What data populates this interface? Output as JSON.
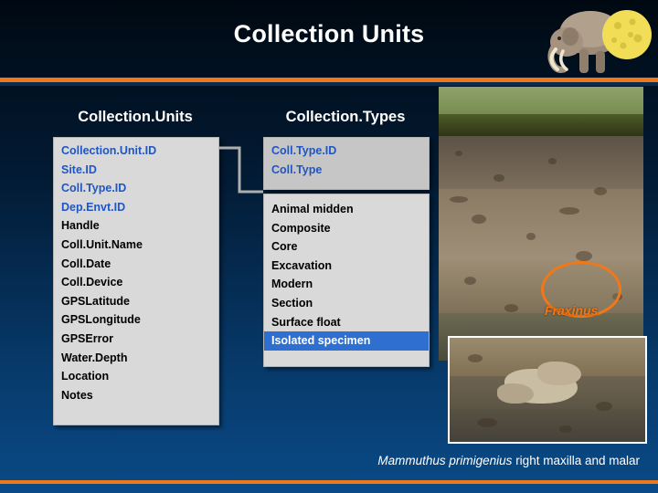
{
  "slide": {
    "title": "Collection Units",
    "accent_orange": "#f07818",
    "accent_blue": "#2f6fd0",
    "background": "#021a33"
  },
  "columns": {
    "units_heading": "Collection.Units",
    "types_heading": "Collection.Types"
  },
  "units_table": {
    "fields": [
      {
        "label": "Collection.Unit.ID",
        "key": true
      },
      {
        "label": "Site.ID",
        "key": true
      },
      {
        "label": "Coll.Type.ID",
        "key": true
      },
      {
        "label": "Dep.Envt.ID",
        "key": true
      },
      {
        "label": "Handle",
        "key": false
      },
      {
        "label": "Coll.Unit.Name",
        "key": false
      },
      {
        "label": "Coll.Date",
        "key": false
      },
      {
        "label": "Coll.Device",
        "key": false
      },
      {
        "label": "GPSLatitude",
        "key": false
      },
      {
        "label": "GPSLongitude",
        "key": false
      },
      {
        "label": "GPSError",
        "key": false
      },
      {
        "label": "Water.Depth",
        "key": false
      },
      {
        "label": "Location",
        "key": false
      },
      {
        "label": "Notes",
        "key": false
      }
    ]
  },
  "types_table": {
    "fields": [
      {
        "label": "Coll.Type.ID",
        "key": true
      },
      {
        "label": "Coll.Type",
        "key": true
      }
    ],
    "values": [
      {
        "label": "Animal midden",
        "selected": false
      },
      {
        "label": "Composite",
        "selected": false
      },
      {
        "label": "Core",
        "selected": false
      },
      {
        "label": "Excavation",
        "selected": false
      },
      {
        "label": "Modern",
        "selected": false
      },
      {
        "label": "Section",
        "selected": false
      },
      {
        "label": "Surface float",
        "selected": false
      },
      {
        "label": "Isolated specimen",
        "selected": true
      }
    ]
  },
  "annotations": {
    "fraxinus_label": "Fraxinus"
  },
  "caption": {
    "species": "Mammuthus primigenius",
    "description": "right maxilla and malar"
  },
  "icons": {
    "mammoth": "mammoth-icon",
    "connector": "relationship-connector-icon",
    "circle_callout": "circle-highlight-icon"
  }
}
